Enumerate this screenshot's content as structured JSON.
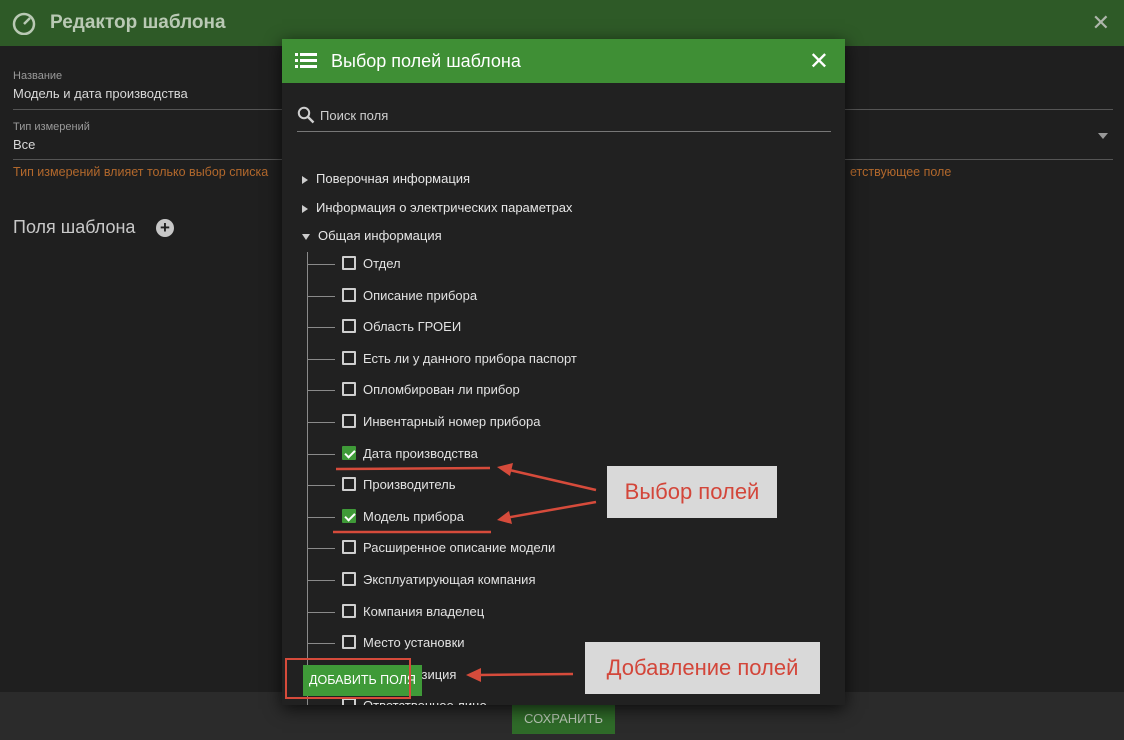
{
  "editor": {
    "title": "Редактор шаблона",
    "close_glyph": "✕",
    "name_label": "Название",
    "name_value": "Модель и дата производства",
    "measure_type_label": "Тип измерений",
    "measure_type_value": "Все",
    "hint_left": "Тип измерений влияет только выбор списка",
    "hint_right": "етствующее поле",
    "fields_title": "Поля шаблона",
    "add_glyph": "+",
    "save_label": "СОХРАНИТЬ"
  },
  "dialog": {
    "title": "Выбор полей шаблона",
    "close_glyph": "✕",
    "search_placeholder": "Поиск поля",
    "groups": [
      {
        "label": "Поверочная информация",
        "expanded": false
      },
      {
        "label": "Информация о электрических параметрах",
        "expanded": false
      },
      {
        "label": "Общая информация",
        "expanded": true
      }
    ],
    "items": [
      {
        "label": "Отдел",
        "checked": false
      },
      {
        "label": "Описание прибора",
        "checked": false
      },
      {
        "label": "Область ГРОЕИ",
        "checked": false
      },
      {
        "label": "Есть ли у данного прибора паспорт",
        "checked": false
      },
      {
        "label": "Опломбирован ли прибор",
        "checked": false
      },
      {
        "label": "Инвентарный номер прибора",
        "checked": false
      },
      {
        "label": "Дата производства",
        "checked": true
      },
      {
        "label": "Производитель",
        "checked": false
      },
      {
        "label": "Модель прибора",
        "checked": true
      },
      {
        "label": "Расширенное описание модели",
        "checked": false
      },
      {
        "label": "Эксплуатирующая компания",
        "checked": false
      },
      {
        "label": "Компания владелец",
        "checked": false
      },
      {
        "label": "Место установки",
        "checked": false
      },
      {
        "label": "ческая позиция",
        "checked": false
      },
      {
        "label": "Ответственное лицо",
        "checked": false
      }
    ],
    "add_button_label": "ДОБАВИТЬ ПОЛЯ"
  },
  "annotations": {
    "select_fields": "Выбор полей",
    "add_fields": "Добавление полей"
  },
  "colors": {
    "header_green": "#3f8f35",
    "annotation_red": "#d3463a",
    "hint_orange": "#b2682c"
  }
}
